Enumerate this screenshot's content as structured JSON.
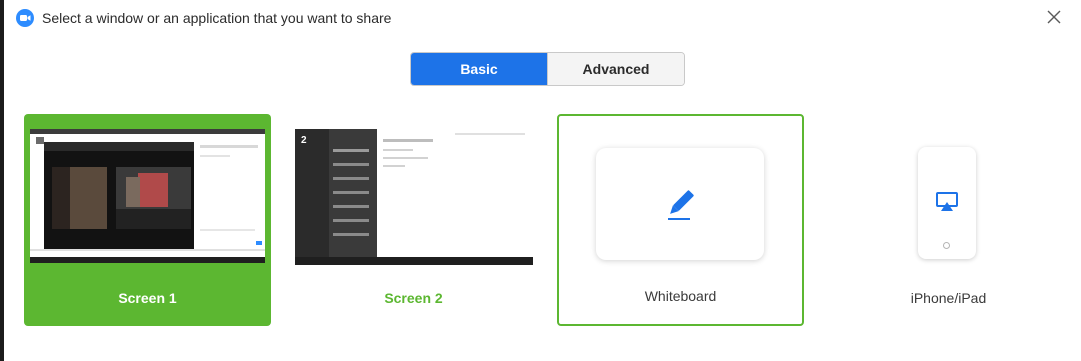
{
  "header": {
    "title": "Select a window or an application that you want to share"
  },
  "tabs": [
    {
      "label": "Basic",
      "active": true
    },
    {
      "label": "Advanced",
      "active": false
    }
  ],
  "share_options": [
    {
      "label": "Screen 1",
      "selected": true
    },
    {
      "label": "Screen 2",
      "selected": false
    },
    {
      "label": "Whiteboard",
      "selected": false
    },
    {
      "label": "iPhone/iPad",
      "selected": false
    }
  ],
  "thumbnails": {
    "screen2_number": "2"
  },
  "icons": {
    "logo": "zoom-logo-icon",
    "close": "close-icon",
    "whiteboard": "pencil-icon",
    "iphone": "airplay-icon"
  },
  "colors": {
    "accent_blue": "#1d73e8",
    "selection_green": "#5cb731"
  }
}
